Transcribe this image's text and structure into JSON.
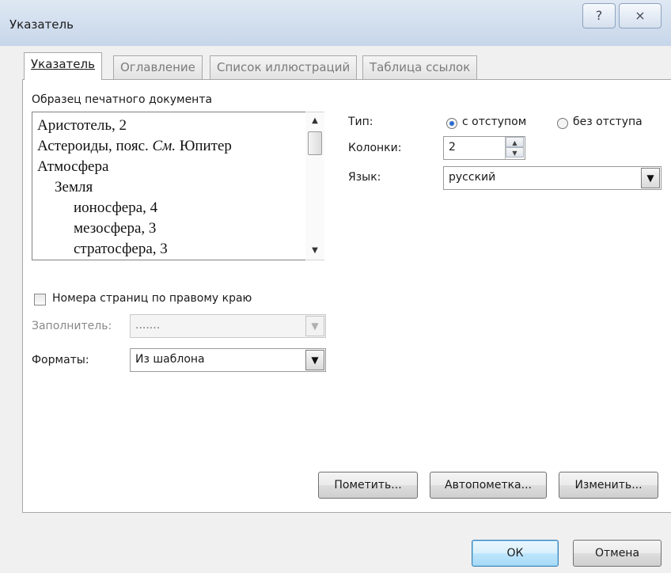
{
  "window": {
    "title": "Указатель",
    "help_glyph": "?",
    "close_glyph": "⨯"
  },
  "tabs": [
    {
      "label": "Указатель",
      "active": true
    },
    {
      "label": "Оглавление",
      "active": false
    },
    {
      "label": "Список иллюстраций",
      "active": false
    },
    {
      "label": "Таблица ссылок",
      "active": false
    }
  ],
  "preview": {
    "label": "Образец печатного документа",
    "lines": [
      "Аристотель, 2",
      "Астероиды, пояс.",
      "См.",
      "Юпитер",
      "Атмосфера",
      "Земля",
      "ионосфера, 4",
      "мезосфера, 3",
      "стратосфера, 3"
    ]
  },
  "type": {
    "label": "Тип:",
    "options": [
      {
        "label": "с отступом",
        "selected": true
      },
      {
        "label": "без отступа",
        "selected": false
      }
    ]
  },
  "columns": {
    "label": "Колонки:",
    "value": "2"
  },
  "language": {
    "label": "Язык:",
    "value": "русский"
  },
  "right_align": {
    "label": "Номера страниц по правому краю",
    "checked": false
  },
  "leader": {
    "label": "Заполнитель:",
    "value": ".......",
    "enabled": false
  },
  "formats": {
    "label": "Форматы:",
    "value": "Из шаблона"
  },
  "buttons": {
    "mark": "Пометить...",
    "automark": "Автопометка...",
    "modify": "Изменить...",
    "ok": "ОК",
    "cancel": "Отмена"
  }
}
